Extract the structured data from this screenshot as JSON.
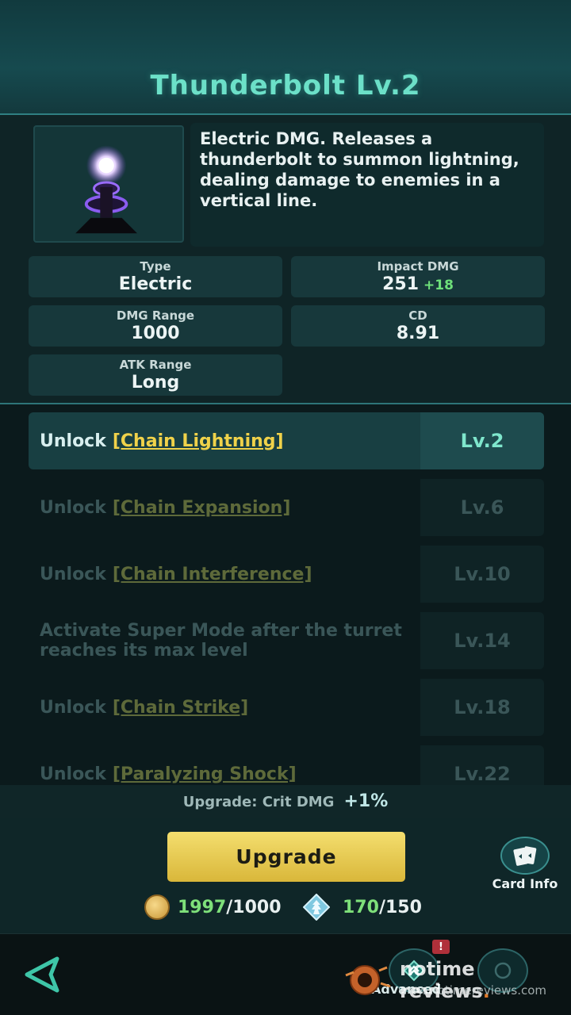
{
  "header": {
    "title": "Thunderbolt  Lv.2"
  },
  "description": "Electric DMG. Releases a thunderbolt to summon lightning, dealing damage to enemies in a vertical line.",
  "stats": {
    "type": {
      "label": "Type",
      "value": "Electric"
    },
    "impact": {
      "label": "Impact DMG",
      "value": "251",
      "bonus": "+18"
    },
    "dmg_range": {
      "label": "DMG Range",
      "value": "1000"
    },
    "cd": {
      "label": "CD",
      "value": "8.91"
    },
    "atk_range": {
      "label": "ATK Range",
      "value": "Long"
    }
  },
  "unlocks": [
    {
      "prefix": "Unlock",
      "skill": "[Chain Lightning]",
      "level": "Lv.2",
      "state": "active"
    },
    {
      "prefix": "Unlock",
      "skill": "[Chain Expansion]",
      "level": "Lv.6",
      "state": "locked"
    },
    {
      "prefix": "Unlock",
      "skill": "[Chain Interference]",
      "level": "Lv.10",
      "state": "locked"
    },
    {
      "prefix": "Activate Super Mode after the turret reaches its max level",
      "skill": "",
      "level": "Lv.14",
      "state": "locked"
    },
    {
      "prefix": "Unlock",
      "skill": "[Chain Strike]",
      "level": "Lv.18",
      "state": "locked"
    },
    {
      "prefix": "Unlock",
      "skill": "[Paralyzing Shock]",
      "level": "Lv.22",
      "state": "locked"
    }
  ],
  "upgrade_bonus": {
    "text": "Upgrade: Crit DMG",
    "value": "+1%"
  },
  "upgrade_button": "Upgrade",
  "card_info": "Card Info",
  "costs": {
    "coins_have": "1997",
    "coins_need": "/1000",
    "crystals_have": "170",
    "crystals_need": "/150"
  },
  "nav": {
    "badge": "!",
    "advanced_label": "Advanced"
  },
  "watermark": {
    "brand": "notime reviews",
    "dot": ".",
    "url": "www.notimereviews.com"
  },
  "colors": {
    "accent": "#6ce0c8",
    "gold": "#f0d24a",
    "green": "#7ee07a"
  }
}
